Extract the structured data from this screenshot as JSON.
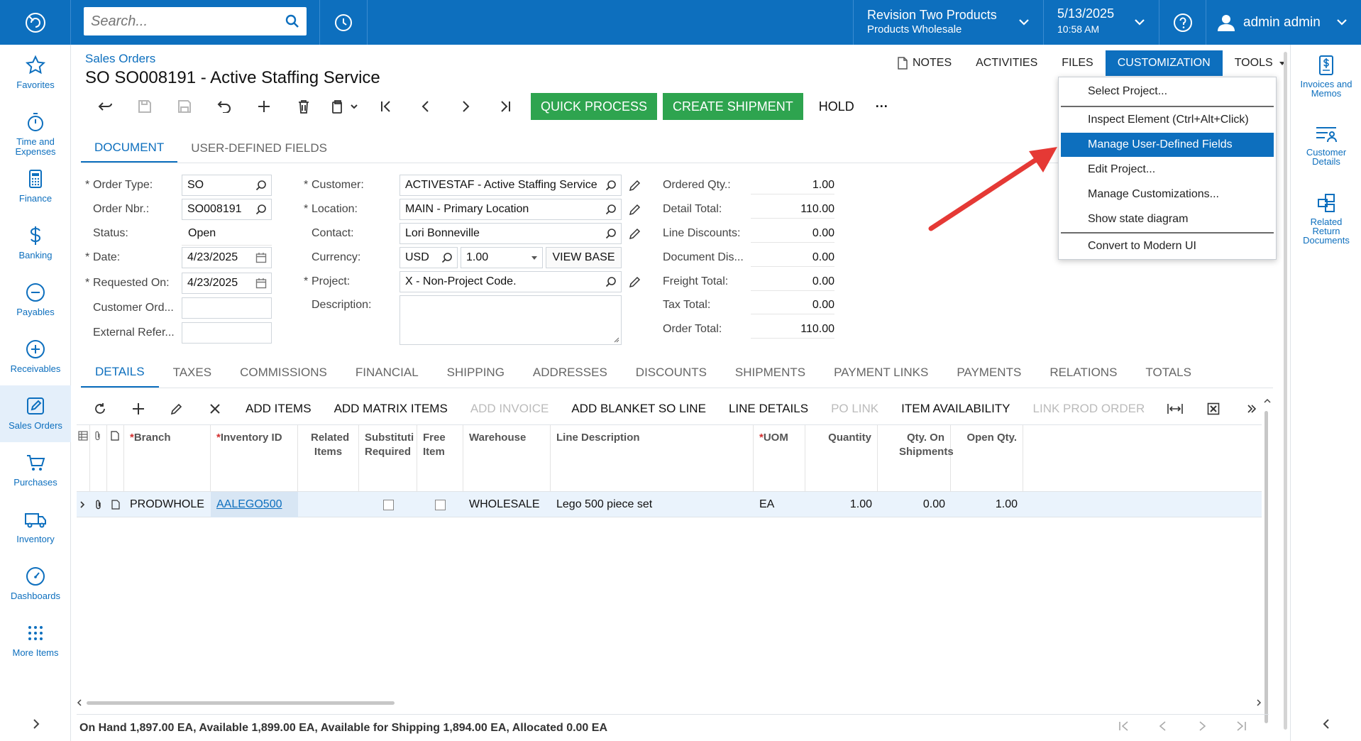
{
  "topbar": {
    "search_placeholder": "Search...",
    "company_line1": "Revision Two Products",
    "company_line2": "Products Wholesale",
    "date": "5/13/2025",
    "time": "10:58 AM",
    "user": "admin admin",
    "brand_color": "#0d6fbe"
  },
  "leftnav": {
    "items": [
      {
        "label": "Favorites",
        "icon": "star-icon"
      },
      {
        "label": "Time and Expenses",
        "icon": "stopwatch-icon"
      },
      {
        "label": "Finance",
        "icon": "calculator-icon"
      },
      {
        "label": "Banking",
        "icon": "dollar-icon"
      },
      {
        "label": "Payables",
        "icon": "minus-circle-icon"
      },
      {
        "label": "Receivables",
        "icon": "plus-circle-icon"
      },
      {
        "label": "Sales Orders",
        "icon": "edit-icon"
      },
      {
        "label": "Purchases",
        "icon": "cart-icon"
      },
      {
        "label": "Inventory",
        "icon": "truck-icon"
      },
      {
        "label": "Dashboards",
        "icon": "gauge-icon"
      },
      {
        "label": "More Items",
        "icon": "grid-dots-icon"
      }
    ]
  },
  "rightnav": {
    "items": [
      {
        "label": "Invoices and Memos",
        "icon": "invoice-icon"
      },
      {
        "label": "Customer Details",
        "icon": "list-user-icon"
      },
      {
        "label": "Related Return Documents",
        "icon": "related-docs-icon"
      }
    ]
  },
  "header": {
    "breadcrumb": "Sales Orders",
    "title": "SO SO008191 - Active Staffing Service",
    "links": {
      "notes": "NOTES",
      "activities": "ACTIVITIES",
      "files": "FILES",
      "customization": "CUSTOMIZATION",
      "tools": "TOOLS"
    }
  },
  "toolbar": {
    "quick_process": "QUICK PROCESS",
    "create_shipment": "CREATE SHIPMENT",
    "hold": "HOLD",
    "more": "···"
  },
  "doc_tabs": [
    "DOCUMENT",
    "USER-DEFINED FIELDS"
  ],
  "form": {
    "order_type_label": "Order Type:",
    "order_type": "SO",
    "order_nbr_label": "Order Nbr.:",
    "order_nbr": "SO008191",
    "status_label": "Status:",
    "status": "Open",
    "date_label": "Date:",
    "date": "4/23/2025",
    "requested_on_label": "Requested On:",
    "requested_on": "4/23/2025",
    "customer_ord_label": "Customer Ord...",
    "customer_ord": "",
    "external_ref_label": "External Refer...",
    "external_ref": "",
    "customer_label": "Customer:",
    "customer": "ACTIVESTAF - Active Staffing Service",
    "location_label": "Location:",
    "location": "MAIN - Primary Location",
    "contact_label": "Contact:",
    "contact": "Lori Bonneville",
    "currency_label": "Currency:",
    "currency": "USD",
    "rate": "1.00",
    "view_base": "VIEW BASE",
    "project_label": "Project:",
    "project": "X - Non-Project Code.",
    "description_label": "Description:",
    "description": ""
  },
  "summary": [
    {
      "label": "Ordered Qty.:",
      "value": "1.00"
    },
    {
      "label": "Detail Total:",
      "value": "110.00"
    },
    {
      "label": "Line Discounts:",
      "value": "0.00"
    },
    {
      "label": "Document Dis...",
      "value": "0.00"
    },
    {
      "label": "Freight Total:",
      "value": "0.00"
    },
    {
      "label": "Tax Total:",
      "value": "0.00"
    },
    {
      "label": "Order Total:",
      "value": "110.00"
    }
  ],
  "grid_tabs": [
    "DETAILS",
    "TAXES",
    "COMMISSIONS",
    "FINANCIAL",
    "SHIPPING",
    "ADDRESSES",
    "DISCOUNTS",
    "SHIPMENTS",
    "PAYMENT LINKS",
    "PAYMENTS",
    "RELATIONS",
    "TOTALS"
  ],
  "grid_toolbar": {
    "add_items": "ADD ITEMS",
    "add_matrix_items": "ADD MATRIX ITEMS",
    "add_invoice": "ADD INVOICE",
    "add_blanket_so_line": "ADD BLANKET SO LINE",
    "line_details": "LINE DETAILS",
    "po_link": "PO LINK",
    "item_availability": "ITEM AVAILABILITY",
    "link_prod_order": "LINK PROD ORDER"
  },
  "grid_columns": {
    "branch": "Branch",
    "inventory_id": "Inventory ID",
    "related_items": "Related Items",
    "substitute_required": "Substituti Required",
    "free_item": "Free Item",
    "warehouse": "Warehouse",
    "line_description": "Line Description",
    "uom": "UOM",
    "quantity": "Quantity",
    "qty_on_shipments": "Qty. On Shipments",
    "open_qty": "Open Qty."
  },
  "grid_rows": [
    {
      "branch": "PRODWHOLE",
      "inventory_id": "AALEGO500",
      "warehouse": "WHOLESALE",
      "line_description": "Lego 500 piece set",
      "uom": "EA",
      "quantity": "1.00",
      "qty_on_shipments": "0.00",
      "open_qty": "1.00"
    }
  ],
  "footer": {
    "availability": "On Hand 1,897.00 EA, Available 1,899.00 EA, Available for Shipping 1,894.00 EA, Allocated 0.00 EA"
  },
  "customization_menu": {
    "items": [
      "Select Project...",
      "Inspect Element (Ctrl+Alt+Click)",
      "Manage User-Defined Fields",
      "Edit Project...",
      "Manage Customizations...",
      "Show state diagram",
      "Convert to Modern UI"
    ],
    "highlighted": "Manage User-Defined Fields"
  },
  "annotation": {
    "arrow_color": "#e53935"
  }
}
